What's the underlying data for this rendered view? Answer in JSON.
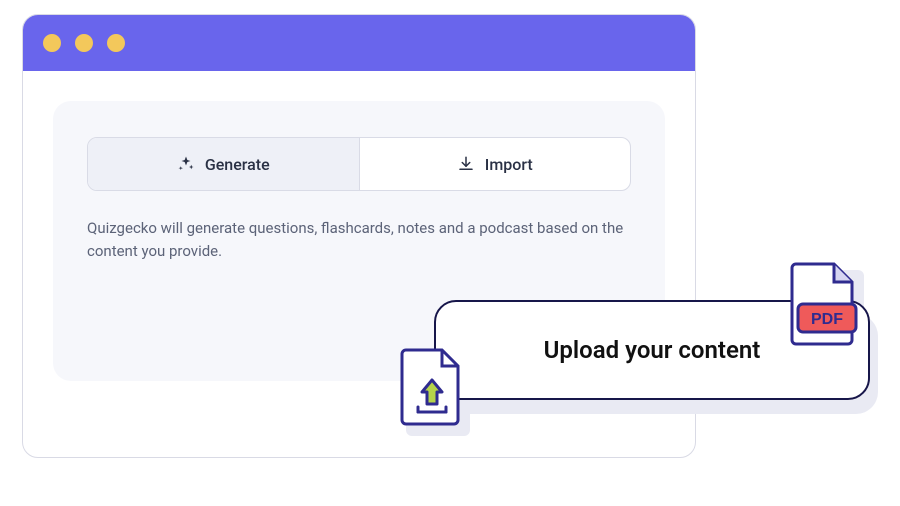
{
  "tabs": {
    "generate": "Generate",
    "import": "Import"
  },
  "description": "Quizgecko will generate questions, flashcards, notes and a podcast based on the content you provide.",
  "callout": "Upload your content",
  "pdf_label": "PDF"
}
